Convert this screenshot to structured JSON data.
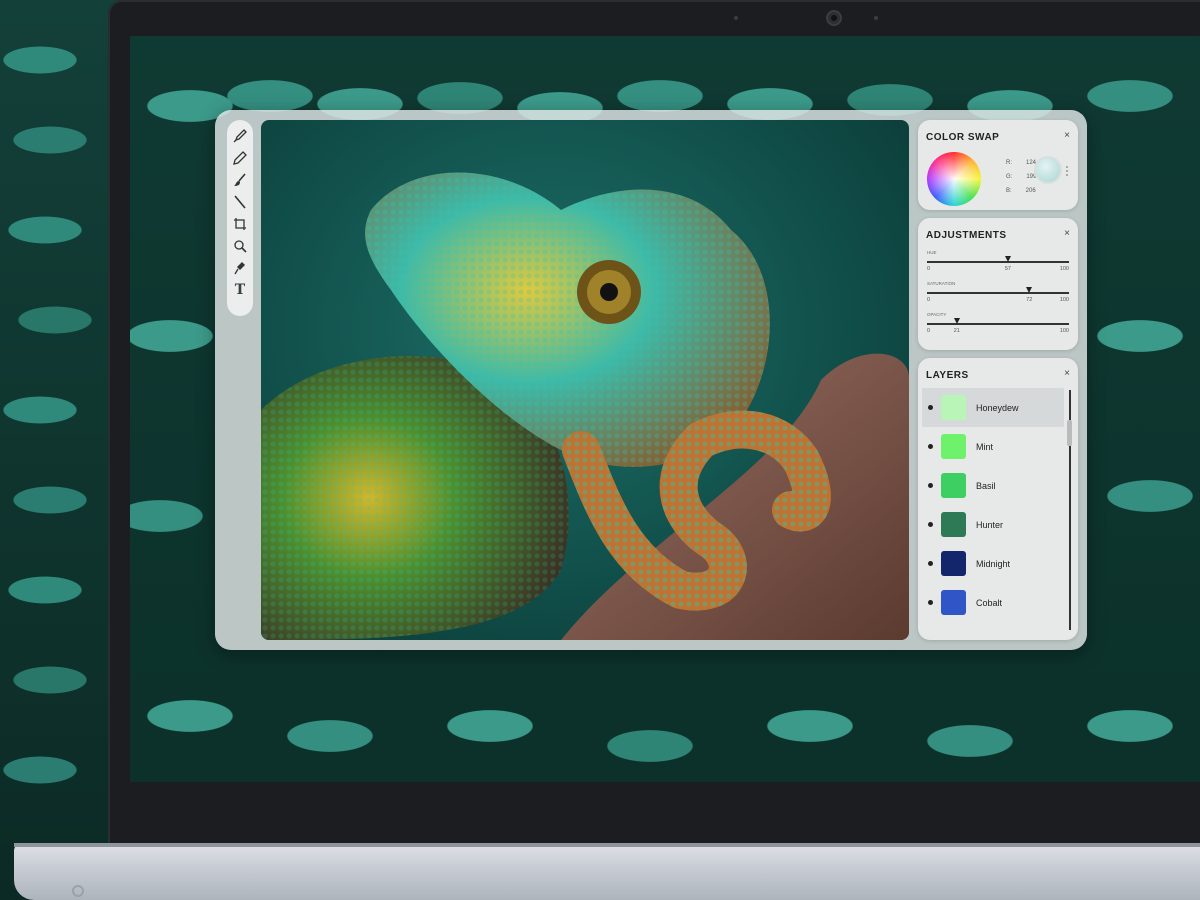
{
  "colors": {
    "accent": "#3c9a8a"
  },
  "toolbar": {
    "tools": [
      {
        "icon": "dropper-icon"
      },
      {
        "icon": "pen-icon"
      },
      {
        "icon": "brush-icon"
      },
      {
        "icon": "pencil-icon"
      },
      {
        "icon": "crop-icon"
      },
      {
        "icon": "magnifier-icon"
      },
      {
        "icon": "stamp-icon"
      },
      {
        "icon": "text-icon",
        "glyph": "T"
      }
    ]
  },
  "color_swap": {
    "title": "COLOR SWAP",
    "close": "×",
    "r_label": "R:",
    "r_value": "124",
    "g_label": "G:",
    "g_value": "199",
    "b_label": "B:",
    "b_value": "206"
  },
  "adjustments": {
    "title": "ADJUSTMENTS",
    "close": "×",
    "sliders": [
      {
        "label": "HUE",
        "min": "0",
        "max": "100",
        "value": "57",
        "level": 0.57
      },
      {
        "label": "SATURATION",
        "min": "0",
        "max": "100",
        "value": "72",
        "level": 0.72
      },
      {
        "label": "OPACITY",
        "min": "0",
        "max": "100",
        "value": "21",
        "level": 0.21
      }
    ]
  },
  "layers": {
    "title": "LAYERS",
    "close": "×",
    "items": [
      {
        "name": "Honeydew",
        "color": "#b8f5b6",
        "selected": true
      },
      {
        "name": "Mint",
        "color": "#6ef26c",
        "selected": false
      },
      {
        "name": "Basil",
        "color": "#3dcf62",
        "selected": false
      },
      {
        "name": "Hunter",
        "color": "#2e7a56",
        "selected": false
      },
      {
        "name": "Midnight",
        "color": "#14266b",
        "selected": false
      },
      {
        "name": "Cobalt",
        "color": "#2f55c7",
        "selected": false
      }
    ]
  }
}
